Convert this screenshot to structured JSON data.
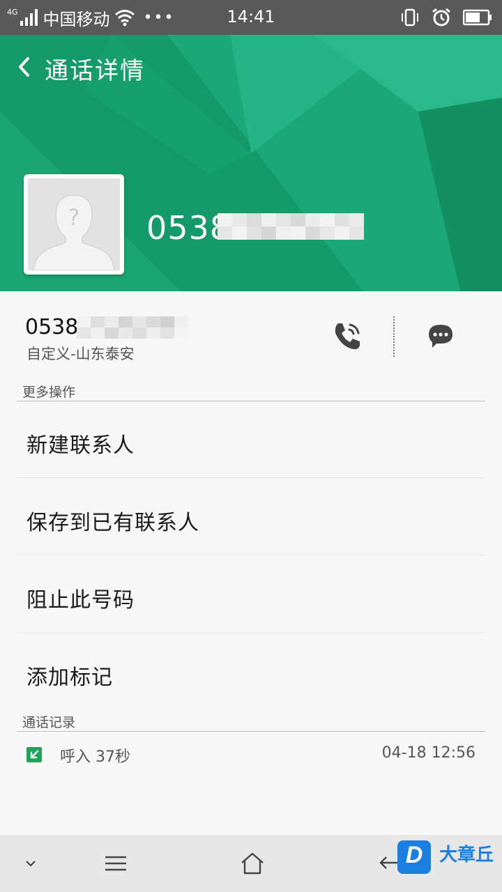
{
  "status_bar": {
    "network_type": "4G",
    "carrier": "中国移动",
    "time": "14:41",
    "icons": [
      "signal-icon",
      "wifi-icon",
      "more-dots-icon",
      "vibrate-icon",
      "alarm-icon",
      "battery-icon"
    ]
  },
  "header": {
    "title": "通话详情",
    "phone_number_visible": "0538",
    "background_color": "#16a06c"
  },
  "contact": {
    "number_visible": "0538",
    "location": "自定义-山东泰安"
  },
  "more_actions": {
    "label": "更多操作",
    "items": [
      {
        "label": "新建联系人"
      },
      {
        "label": "保存到已有联系人"
      },
      {
        "label": "阻止此号码"
      },
      {
        "label": "添加标记"
      }
    ]
  },
  "call_log": {
    "label": "通话记录",
    "entries": [
      {
        "type": "呼入",
        "duration": "37秒",
        "time": "04-18 12:56"
      }
    ]
  },
  "watermark": {
    "text": "大章丘"
  },
  "colors": {
    "accent_green": "#16a06c",
    "status_bar": "#595959",
    "incoming_icon": "#22a35a"
  }
}
